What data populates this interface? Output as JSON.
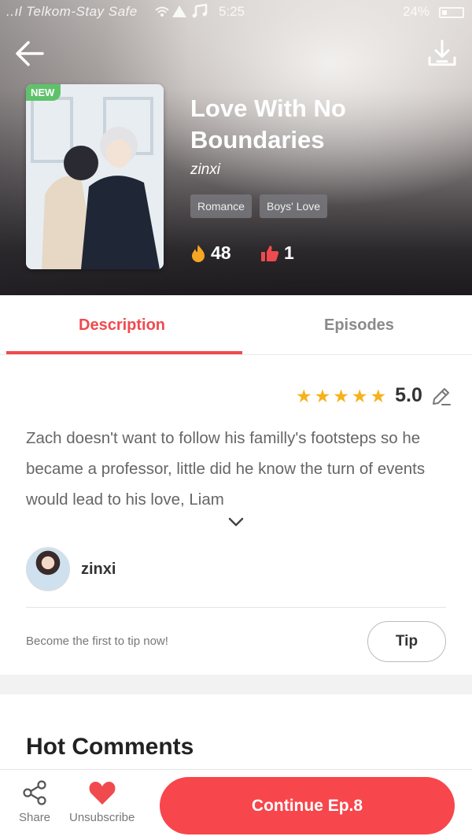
{
  "status_bar": {
    "carrier": "..ıl Telkom-Stay Safe",
    "time": "5:25",
    "battery": "24%"
  },
  "header": {
    "back_icon": "arrow-left-icon",
    "download_icon": "download-icon"
  },
  "comic": {
    "badge": "NEW",
    "title": "Love With No Boundaries",
    "author": "zinxi",
    "tags": [
      "Romance",
      "Boys' Love"
    ],
    "fire_count": "48",
    "like_count": "1"
  },
  "tabs": [
    {
      "label": "Description",
      "active": true
    },
    {
      "label": "Episodes",
      "active": false
    }
  ],
  "description": {
    "rating": "5.0",
    "stars": 5,
    "text": "Zach doesn't want to follow his familly's footsteps so he became a professor, little did he know the turn of events would lead to his love, Liam"
  },
  "creator": {
    "name": "zinxi"
  },
  "tip": {
    "prompt": "Become the first to tip now!",
    "button": "Tip"
  },
  "comments": {
    "title": "Hot Comments"
  },
  "bottom_bar": {
    "share_label": "Share",
    "unsubscribe_label": "Unsubscribe",
    "continue_label": "Continue Ep.8"
  },
  "colors": {
    "accent": "#f04a4f",
    "star": "#f6b21b",
    "new_badge": "#5fc26b"
  }
}
